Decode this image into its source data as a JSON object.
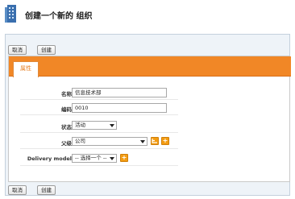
{
  "header": {
    "title": "创建一个新的 组织",
    "icon": "building-icon"
  },
  "toolbar_top": {
    "cancel": "取消",
    "create": "创建"
  },
  "toolbar_bottom": {
    "cancel": "取消",
    "create": "创建"
  },
  "tabs": [
    {
      "label": "属性",
      "active": true
    }
  ],
  "form": {
    "name": {
      "label": "名称",
      "value": "信息技术部"
    },
    "code": {
      "label": "编码",
      "value": "0010"
    },
    "status": {
      "label": "状态",
      "selected": "活动"
    },
    "parent": {
      "label": "父级",
      "selected": "公司"
    },
    "delivery_model": {
      "label": "Delivery model",
      "selected": "-- 选择一个 --"
    }
  },
  "colors": {
    "accent": "#f18726",
    "tab_text": "#e67e22",
    "frame_bg": "#eef3f8",
    "mini_button": "#f39c12"
  }
}
